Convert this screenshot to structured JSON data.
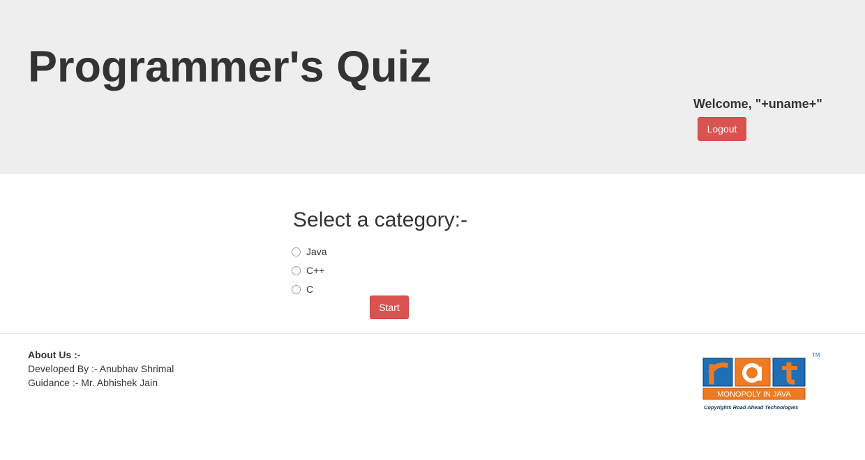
{
  "header": {
    "title": "Programmer's Quiz",
    "welcome": "Welcome, \"+uname+\"",
    "logout_label": "Logout"
  },
  "main": {
    "heading": "Select a category:-",
    "options": [
      "Java",
      "C++",
      "C"
    ],
    "start_label": "Start"
  },
  "footer": {
    "about_title": "About Us :-",
    "developed_by": "Developed By :- Anubhav Shrimal",
    "guidance": "Guidance :- Mr. Abhishek Jain"
  },
  "logo": {
    "letters": "rat",
    "tagline": "MONOPOLY IN JAVA",
    "copyright": "Copyrights Road Ahead Technologies",
    "tm": "TM"
  },
  "colors": {
    "danger": "#d9534f",
    "jumbotron": "#eeeeee",
    "logo_blue": "#1f6fb5",
    "logo_orange": "#f07a22"
  }
}
